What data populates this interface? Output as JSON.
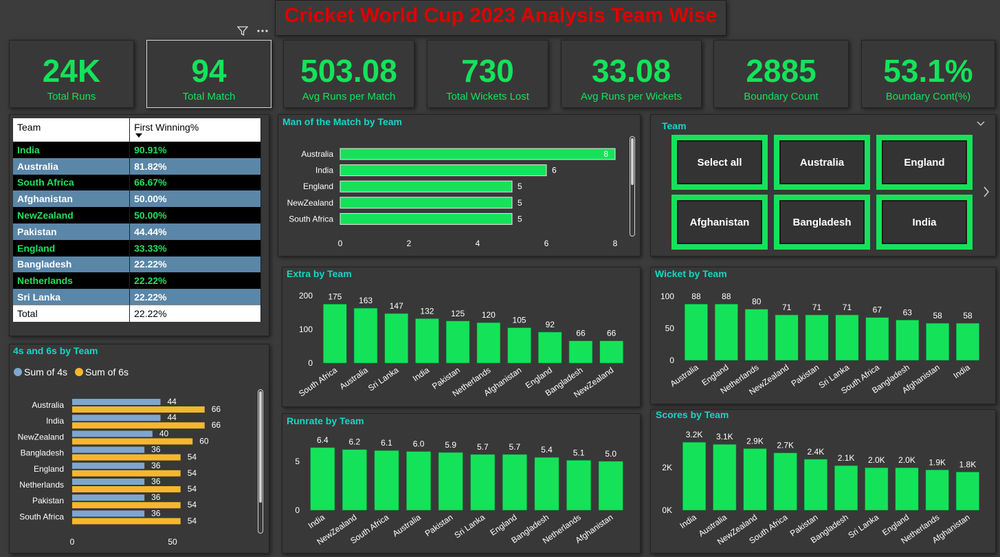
{
  "title": "Cricket World Cup 2023 Analysis Team Wise",
  "kpis": [
    {
      "value": "24K",
      "label": "Total Runs"
    },
    {
      "value": "94",
      "label": "Total Match"
    },
    {
      "value": "503.08",
      "label": "Avg Runs per Match"
    },
    {
      "value": "730",
      "label": "Total Wickets Lost"
    },
    {
      "value": "33.08",
      "label": "Avg Runs per Wickets"
    },
    {
      "value": "2885",
      "label": "Boundary Count"
    },
    {
      "value": "53.1%",
      "label": "Boundary Cont(%)"
    }
  ],
  "table": {
    "headers": [
      "Team",
      "First Winning%"
    ],
    "rows": [
      [
        "India",
        "90.91%"
      ],
      [
        "Australia",
        "81.82%"
      ],
      [
        "South Africa",
        "66.67%"
      ],
      [
        "Afghanistan",
        "50.00%"
      ],
      [
        "NewZealand",
        "50.00%"
      ],
      [
        "Pakistan",
        "44.44%"
      ],
      [
        "England",
        "33.33%"
      ],
      [
        "Bangladesh",
        "22.22%"
      ],
      [
        "Netherlands",
        "22.22%"
      ],
      [
        "Sri Lanka",
        "22.22%"
      ]
    ],
    "total": [
      "Total",
      "22.22%"
    ]
  },
  "slicer": {
    "title": "Team",
    "buttons": [
      "Select all",
      "Australia",
      "England",
      "Afghanistan",
      "Bangladesh",
      "India"
    ]
  },
  "colors": {
    "green": "#14e35a",
    "blue": "#7fa6cf",
    "orange": "#f5b72d",
    "title_red": "#e00000",
    "accent": "#17d6c6"
  },
  "chart_data": [
    {
      "id": "motm",
      "type": "bar",
      "orientation": "horizontal",
      "title": "Man of the Match by Team",
      "categories": [
        "Australia",
        "India",
        "England",
        "NewZealand",
        "South Africa"
      ],
      "values": [
        8,
        6,
        5,
        5,
        5
      ],
      "labels": [
        "8",
        "6",
        "5",
        "5",
        "5"
      ],
      "xticks": [
        "0",
        "2",
        "4",
        "6",
        "8"
      ],
      "xlim": [
        0,
        8
      ]
    },
    {
      "id": "extra",
      "type": "bar",
      "title": "Extra by Team",
      "categories": [
        "South Africa",
        "Australia",
        "Sri Lanka",
        "India",
        "Pakistan",
        "Netherlands",
        "Afghanistan",
        "England",
        "Bangladesh",
        "NewZealand"
      ],
      "values": [
        175,
        163,
        147,
        132,
        125,
        120,
        105,
        92,
        66,
        66
      ],
      "labels": [
        "175",
        "163",
        "147",
        "132",
        "125",
        "120",
        "105",
        "92",
        "66",
        "66"
      ],
      "yticks": [
        "0",
        "100",
        "200"
      ],
      "ylim": [
        0,
        200
      ]
    },
    {
      "id": "wicket",
      "type": "bar",
      "title": "Wicket by Team",
      "categories": [
        "Australia",
        "England",
        "Netherlands",
        "NewZealand",
        "Pakistan",
        "Sri Lanka",
        "South Africa",
        "Bangladesh",
        "Afghanistan",
        "India"
      ],
      "values": [
        88,
        88,
        80,
        71,
        71,
        71,
        67,
        63,
        58,
        58
      ],
      "labels": [
        "88",
        "88",
        "80",
        "71",
        "71",
        "71",
        "67",
        "63",
        "58",
        "58"
      ],
      "yticks": [
        "0",
        "50",
        "100"
      ],
      "ylim": [
        0,
        100
      ]
    },
    {
      "id": "runrate",
      "type": "bar",
      "title": "Runrate by Team",
      "categories": [
        "India",
        "NewZealand",
        "South Africa",
        "Australia",
        "Pakistan",
        "Sri Lanka",
        "England",
        "Bangladesh",
        "Netherlands",
        "Afghanistan"
      ],
      "values": [
        6.4,
        6.2,
        6.1,
        6.0,
        5.9,
        5.7,
        5.7,
        5.4,
        5.1,
        5.0
      ],
      "labels": [
        "6.4",
        "6.2",
        "6.1",
        "6.0",
        "5.9",
        "5.7",
        "5.7",
        "5.4",
        "5.1",
        "5.0"
      ],
      "yticks": [
        "0",
        "5"
      ],
      "ylim": [
        0,
        6.6
      ]
    },
    {
      "id": "scores",
      "type": "bar",
      "title": "Scores by Team",
      "categories": [
        "India",
        "Australia",
        "NewZealand",
        "South Africa",
        "Pakistan",
        "Bangladesh",
        "Sri Lanka",
        "England",
        "Netherlands",
        "Afghanistan"
      ],
      "values": [
        3200,
        3100,
        2900,
        2700,
        2400,
        2100,
        2000,
        2000,
        1900,
        1800
      ],
      "labels": [
        "3.2K",
        "3.1K",
        "2.9K",
        "2.7K",
        "2.4K",
        "2.1K",
        "2.0K",
        "2.0K",
        "1.9K",
        "1.8K"
      ],
      "yticks": [
        "0K",
        "2K"
      ],
      "ylim": [
        0,
        3300
      ]
    },
    {
      "id": "fours_sixes",
      "type": "bar",
      "orientation": "horizontal",
      "title": "4s and 6s by Team",
      "legend": "top-left",
      "categories": [
        "Australia",
        "India",
        "NewZealand",
        "Bangladesh",
        "England",
        "Netherlands",
        "Pakistan",
        "South Africa"
      ],
      "series": [
        {
          "name": "Sum of 4s",
          "values": [
            44,
            44,
            40,
            36,
            36,
            36,
            36,
            36
          ]
        },
        {
          "name": "Sum of 6s",
          "values": [
            66,
            66,
            60,
            54,
            54,
            54,
            54,
            54
          ]
        }
      ],
      "xticks": [
        "0",
        "50"
      ],
      "xlim": [
        0,
        88
      ]
    }
  ]
}
